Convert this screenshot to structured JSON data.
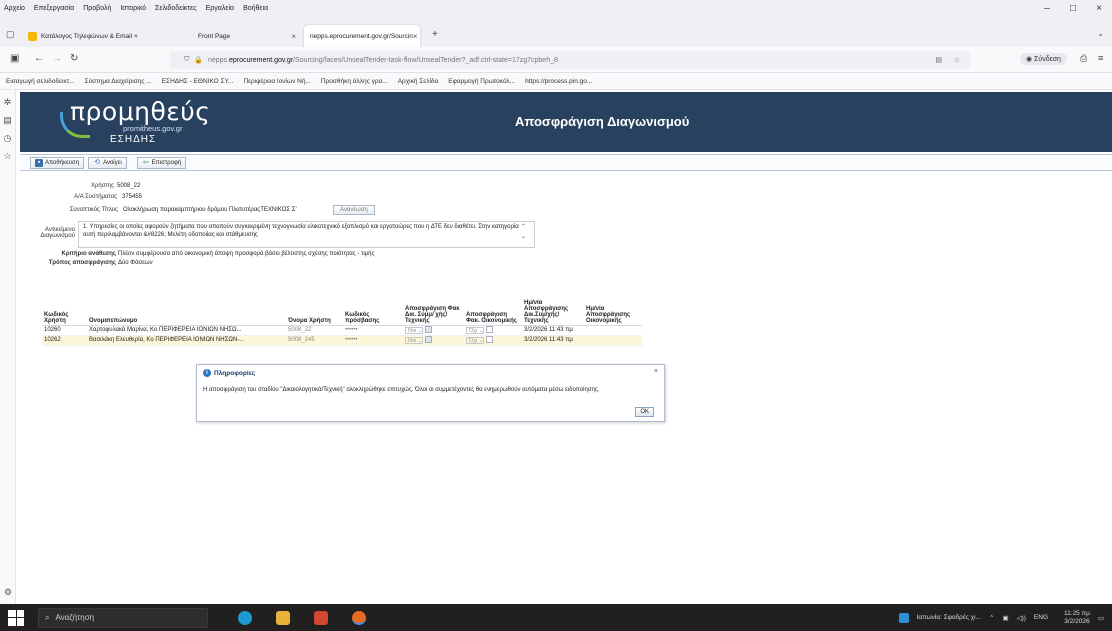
{
  "menubar": {
    "items": [
      "Αρχείο",
      "Επεξεργασία",
      "Προβολή",
      "Ιστορικό",
      "Σελιδοδείκτες",
      "Εργαλεία",
      "Βοήθεια"
    ]
  },
  "window_controls": [
    "–",
    "□",
    "×"
  ],
  "tabs": [
    {
      "label": "Κατάλογος Τηλεφώνων & Email ×",
      "color": "#f5b800"
    },
    {
      "label": "Front Page",
      "color": "#ffffff"
    },
    {
      "label": "nepps.eprocurement.gov.gr/Sourcin",
      "color": "#ffffff"
    }
  ],
  "tab_new": "+",
  "nav": {
    "url_prefix": "nepps.",
    "url_domain": "eprocurement.gov.gr",
    "url_rest": "/Sourcing/faces/UnsealTender-task-flow/UnsealTender?_adf.ctrl-state=17zg7cpbeh_8",
    "login_label": "Σύνδεση"
  },
  "bookmarks": [
    "Εισαγωγή σελιδοδεικτ...",
    "Σύστημα Διαχείρισης ...",
    "ΕΣΗΔΗΣ - ΕΘΝΙΚΟ ΣΥ...",
    "Περιφέρεια Ιονίων Νή...",
    "Προσθήκη άλλης γρα...",
    "Αρχική Σελίδα",
    "Εφαρμογή Πρωτοκόλ...",
    "https://process.pin.go..."
  ],
  "sidebar_icons": [
    "extensions-icon",
    "bookmarks-icon",
    "history-icon",
    "star-icon"
  ],
  "banner": {
    "logo_main": "προμηθεύς",
    "logo_sub": "promitheus.gov.gr",
    "logo_esidis": "ΕΣΗΔΗΣ",
    "title": "Αποσφράγιση Διαγωνισμού",
    "bg": "#27415f"
  },
  "toolbar": {
    "save": "Αποθήκευση",
    "open": "Ανοίγει",
    "back": "Επιστροφή"
  },
  "form": {
    "user_label": "Χρήστης",
    "user_value": "5008_22",
    "system_no_label": "Α/Α Συστήματος",
    "system_no_value": "375455",
    "title_label": "Συνοπτικός Τίτλος",
    "title_value": "Ολοκλήρωση παρακαμπτήριου δρόμου ΠλατυτέραςΤΕΧΝΙΚΟΣ Σ'",
    "expand_label": "Ανανέωση",
    "subject_label": "Αντικείμενο Διαγωνισμού",
    "subject_value": "1. Υπηρεσίες οι οποίες αφορούν ζητήματα που απαιτούν συγκεκριμένη τεχνογνωσία υλικοτεχνικό εξοπλισμό και εργατοώρες που η ΔΤΕ δεν διαθέτει. Στην κατηγορία αυτή περιλαμβάνονται &#8226; Μελέτη οδοποιίας και στάθμευσης",
    "criterion_label": "Κριτήριο ανάθεσης",
    "criterion_value": "Πλέον συμφέρουσα από οικονομική άποψη προσφορά βάσει βέλτιστης σχέσης ποιότητας - τιμής",
    "method_label": "Τρόπος αποσφράγισης",
    "method_value": "Δύο Φάσεων"
  },
  "grid": {
    "headers": [
      "Κωδικός Χρήστη",
      "Ονοματεπώνυμο",
      "Όνομα Χρήστη",
      "Κωδικός πρόσβασης",
      "Αποσφράγιση Φακ Δικ. Συμμ/ χής/Τεχνικής",
      "Αποσφράγιση Φακ. Οικονομικής",
      "Ημ/νία Αποσφράγισης Δικ.Συμ/χής/ Τεχνικής",
      "Ημ/νία Αποσφράγισης Οικονομικής"
    ],
    "rows": [
      {
        "code": "10260",
        "name": "Χαρτοφυλακά Μαρίνα, Κο ΠΕΡΙΦΕΡΕΙΑ ΙΟΝΙΩΝ ΝΗΣΩ...",
        "username": "5008_22",
        "password": "••••••",
        "tech_select": "Ναι",
        "econ_select": "Όχι",
        "tech_date": "3/2/2026 11:43 πμ",
        "econ_date": ""
      },
      {
        "code": "10262",
        "name": "Βασιλάκη Ελευθερία, Κο ΠΕΡΙΦΕΡΕΙΑ ΙΟΝΙΩΝ ΝΗΣΩΝ-...",
        "username": "5008_245",
        "password": "••••••",
        "tech_select": "Ναι",
        "econ_select": "Όχι",
        "tech_date": "3/2/2026 11:43 πμ",
        "econ_date": ""
      }
    ]
  },
  "dialog": {
    "title": "Πληροφορίες",
    "message": "Η αποσφράγιση του σταδίου \"Δικαιολογητικά/Τεχνική\" ολοκληρώθηκε επιτυχώς. Όλοι οι συμμετέχοντες θα ενημερωθούν αυτόματα μέσω ειδοποίησης.",
    "ok": "OK",
    "close": "×"
  },
  "taskbar": {
    "search_placeholder": "Αναζήτηση",
    "weather": "Ιαπωνία: Σφοδρές χι...",
    "lang": "ENG",
    "time": "11:25 πμ",
    "date": "3/2/2026"
  }
}
